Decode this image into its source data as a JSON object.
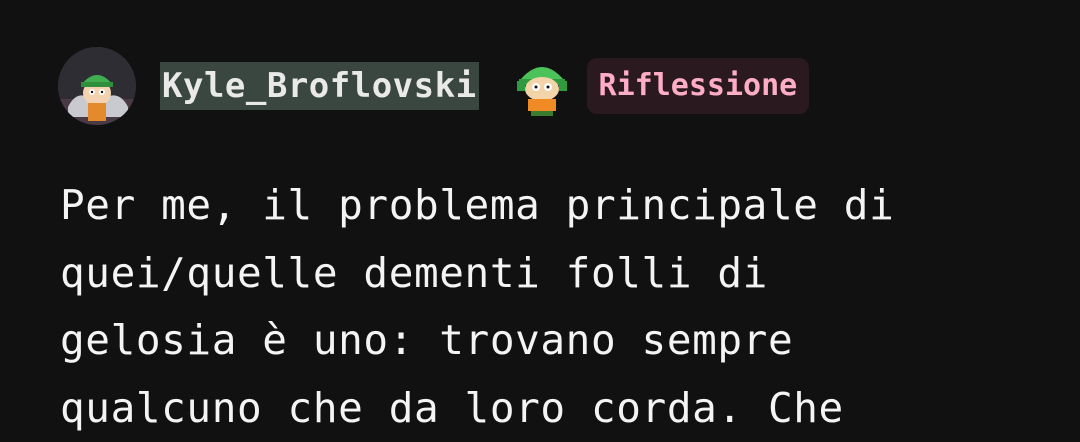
{
  "post": {
    "author": {
      "avatar_icon": "kyle-avatar-icon",
      "username": "Kyle_Broflovski",
      "badge_icon": "kyle-character-icon"
    },
    "tag": {
      "label": "Riflessione",
      "text_color": "#ffadc6",
      "background": "#2a1a20"
    },
    "body_lines": [
      "Per me, il problema principale di",
      "quei/quelle dementi folli di",
      "gelosia è uno: trovano sempre",
      "qualcuno che da loro corda. Che"
    ]
  },
  "colors": {
    "page_background": "#111111",
    "text": "#f4f4f4",
    "username_highlight": "#3a4740"
  }
}
